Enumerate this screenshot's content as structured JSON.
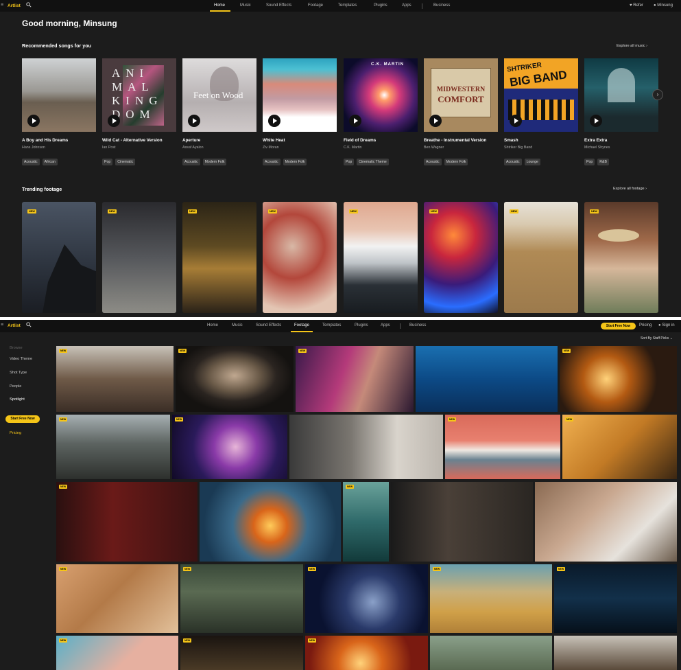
{
  "brand": {
    "logo": "Artlist",
    "accent": "#f5c518"
  },
  "nav1": {
    "items": [
      "Home",
      "Music",
      "Sound Effects",
      "Footage",
      "Templates",
      "Plugins",
      "Apps",
      "Business"
    ],
    "active": "Home",
    "refer": "Refer",
    "user": "Minsung"
  },
  "greeting": "Good morning, Minsung",
  "recommended": {
    "title": "Recommended songs for you",
    "explore": "Explore all music",
    "songs": [
      {
        "title": "A Boy and His Dreams",
        "artist": "Hans Johnson",
        "tags": [
          "Acoustic",
          "African"
        ]
      },
      {
        "title": "Wild Cat - Alternative Version",
        "artist": "Ian Post",
        "tags": [
          "Pop",
          "Cinematic"
        ]
      },
      {
        "title": "Aperture",
        "artist": "Assaf Ayalon",
        "tags": [
          "Acoustic",
          "Modern Folk"
        ]
      },
      {
        "title": "White Heat",
        "artist": "Ziv Moran",
        "tags": [
          "Acoustic",
          "Modern Folk"
        ]
      },
      {
        "title": "Field of Dreams",
        "artist": "C.K. Martin",
        "tags": [
          "Pop",
          "Cinematic Theme"
        ]
      },
      {
        "title": "Breathe - Instrumental Version",
        "artist": "Ben Wagner",
        "tags": [
          "Acoustic",
          "Modern Folk"
        ]
      },
      {
        "title": "Smash",
        "artist": "Shtriker Big Band",
        "tags": [
          "Acoustic",
          "Lounge"
        ]
      },
      {
        "title": "Extra Extra",
        "artist": "Michael Shynes",
        "tags": [
          "Pop",
          "R&B"
        ]
      }
    ],
    "cover_text": {
      "c2": "ANI MAL KING DOM",
      "c3": "Feet on Wood",
      "c5": "C.K. MARTIN",
      "c6a": "MIDWESTERN",
      "c6b": "COMFORT",
      "c7a": "SHTRIKER",
      "c7b": "BIG BAND"
    }
  },
  "trending": {
    "title": "Trending footage",
    "explore": "Explore all footage",
    "badge": "NEW"
  },
  "nav2": {
    "items": [
      "Home",
      "Music",
      "Sound Effects",
      "Footage",
      "Templates",
      "Plugins",
      "Apps",
      "Business"
    ],
    "active": "Footage",
    "start": "Start Free Now",
    "pricing": "Pricing",
    "signin": "Sign in"
  },
  "sort": "Sort By Staff Picks",
  "sidebar": {
    "browse": "Browse",
    "items": [
      "Video Theme",
      "Shot Type",
      "People",
      "Spotlight"
    ],
    "start": "Start Free Now",
    "pricing": "Pricing"
  },
  "grid_badge": "NEW"
}
